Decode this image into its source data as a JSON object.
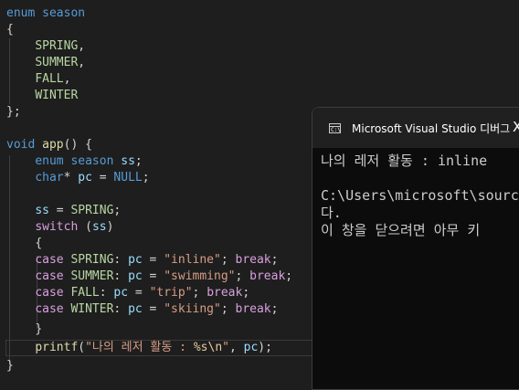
{
  "editor": {
    "lines": {
      "l1": {
        "kw": "enum",
        "name": "season"
      },
      "l2": "{",
      "l3": "SPRING",
      "l4": "SUMMER",
      "l5": "FALL",
      "l6": "WINTER",
      "l7": "};",
      "l9": {
        "kw": "void",
        "fn": "app",
        "rest": "() {"
      },
      "l10": {
        "kw": "enum",
        "type": "season",
        "var": "ss",
        "end": ";"
      },
      "l11": {
        "kw": "char",
        "star": "*",
        "var": "pc",
        "eq": " = ",
        "val": "NULL",
        "end": ";"
      },
      "l13": {
        "var": "ss",
        "eq": " = ",
        "val": "SPRING",
        "end": ";"
      },
      "l14": {
        "kw": "switch",
        "rest": " (",
        "var": "ss",
        "end": ")"
      },
      "l15": "{",
      "l16": {
        "kw": "case",
        "label": "SPRING",
        "var": "pc",
        "str": "\"inline\"",
        "brk": "break"
      },
      "l17": {
        "kw": "case",
        "label": "SUMMER",
        "var": "pc",
        "str": "\"swimming\"",
        "brk": "break"
      },
      "l18": {
        "kw": "case",
        "label": "FALL",
        "var": "pc",
        "str": "\"trip\"",
        "brk": "break"
      },
      "l19": {
        "kw": "case",
        "label": "WINTER",
        "var": "pc",
        "str": "\"skiing\"",
        "brk": "break"
      },
      "l20": "}",
      "l21": {
        "fn": "printf",
        "open": "(",
        "str1": "\"나의 레저 활동 : ",
        "fmt": "%s",
        "esc": "\\n",
        "str2": "\"",
        "comma": ", ",
        "var": "pc",
        "end": ");"
      },
      "l22": "}"
    }
  },
  "console": {
    "title": "Microsoft Visual Studio 디버그",
    "icon_label": "C:\\",
    "close_label": "X",
    "output": [
      "나의 레저 활동 : inline",
      "",
      "C:\\Users\\microsoft\\source",
      "다.",
      "이 창을 닫으려면 아무 키"
    ]
  },
  "colors": {
    "background": "#1e1e1e",
    "keyword": "#569cd6",
    "control": "#d8a0df",
    "function": "#dcdcaa",
    "string": "#d69d85",
    "enum_value": "#b8d7a3",
    "variable": "#9cdcfe",
    "console_bg": "#0c0c0c"
  }
}
